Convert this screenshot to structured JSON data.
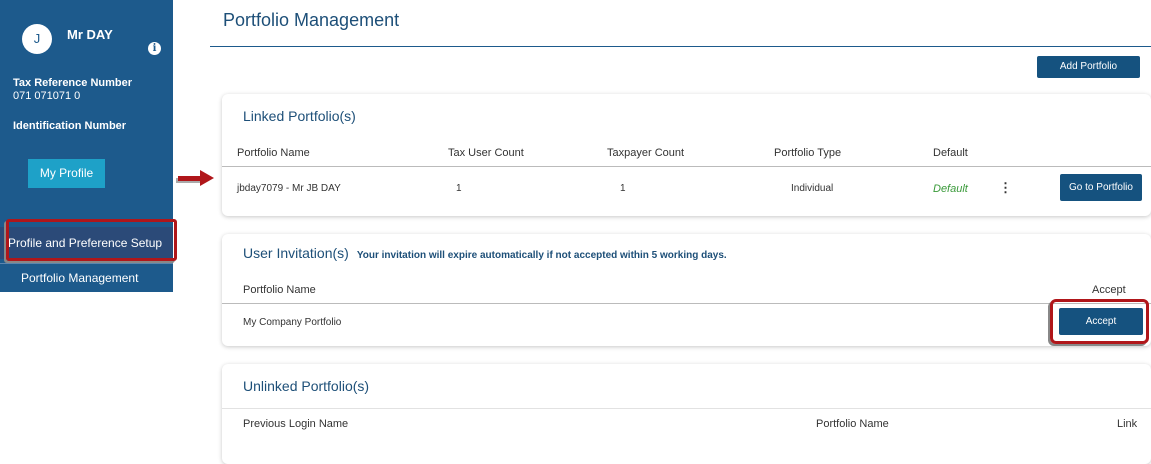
{
  "user": {
    "avatar_initial": "J",
    "name": "Mr  DAY",
    "info_icon": "i",
    "tax_reference_label": "Tax Reference Number",
    "tax_reference_value": "071 071071 0",
    "identification_label": "Identification Number",
    "my_profile_button": "My Profile"
  },
  "sidebar_nav": {
    "profile_preference": "Profile and Preference Setup",
    "portfolio_management": "Portfolio Management"
  },
  "page": {
    "title": "Portfolio Management",
    "add_portfolio_button": "Add Portfolio"
  },
  "linked": {
    "title": "Linked Portfolio(s)",
    "columns": [
      "Portfolio Name",
      "Tax User Count",
      "Taxpayer Count",
      "Portfolio Type",
      "Default"
    ],
    "rows": [
      {
        "portfolio_name": "jbday7079 - Mr JB DAY",
        "tax_user_count": "1",
        "taxpayer_count": "1",
        "portfolio_type": "Individual",
        "default": "Default",
        "action": "Go to Portfolio"
      }
    ]
  },
  "invitations": {
    "title": "User Invitation(s)",
    "note": "Your invitation will expire automatically if not accepted within 5 working days.",
    "columns": [
      "Portfolio Name",
      "Accept"
    ],
    "rows": [
      {
        "portfolio_name": "My Company Portfolio",
        "action": "Accept"
      }
    ]
  },
  "unlinked": {
    "title": "Unlinked Portfolio(s)",
    "columns": [
      "Previous Login Name",
      "Portfolio Name",
      "Link"
    ]
  },
  "colors": {
    "sidebar": "#1d5a8c",
    "accent_button": "#1ea1c8",
    "navy_button": "#15527f",
    "highlight": "#b0161a",
    "default_text": "#3a9a3a"
  },
  "icons": {
    "info": "info-icon",
    "more": "kebab-menu-icon",
    "arrow": "right-arrow-annotation"
  }
}
